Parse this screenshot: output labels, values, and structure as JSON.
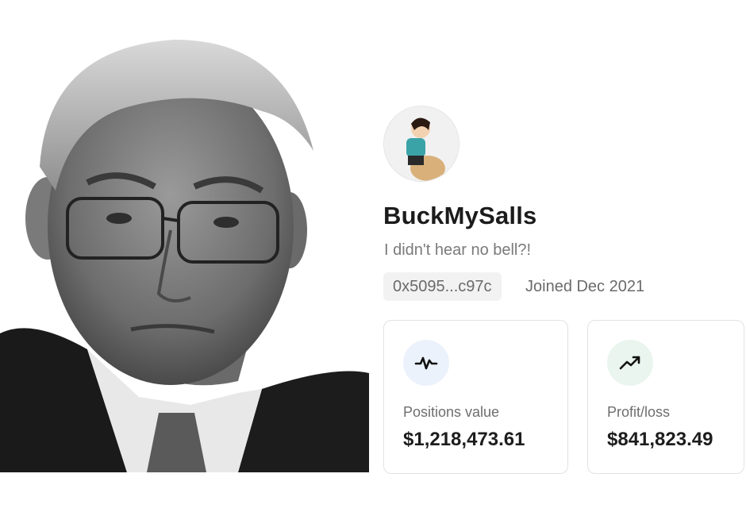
{
  "profile": {
    "username": "BuckMySalls",
    "bio": "I didn't hear no bell?!",
    "address": "0x5095...c97c",
    "joined": "Joined Dec 2021"
  },
  "stats": {
    "positions": {
      "label": "Positions value",
      "value": "$1,218,473.61",
      "icon": "activity-icon"
    },
    "pnl": {
      "label": "Profit/loss",
      "value": "$841,823.49",
      "icon": "trending-up-icon"
    }
  },
  "colors": {
    "positions_icon_bg": "#ecf2fb",
    "pnl_icon_bg": "#e9f5ee",
    "text_primary": "#1b1b1b",
    "text_muted": "#7a7a7a"
  }
}
